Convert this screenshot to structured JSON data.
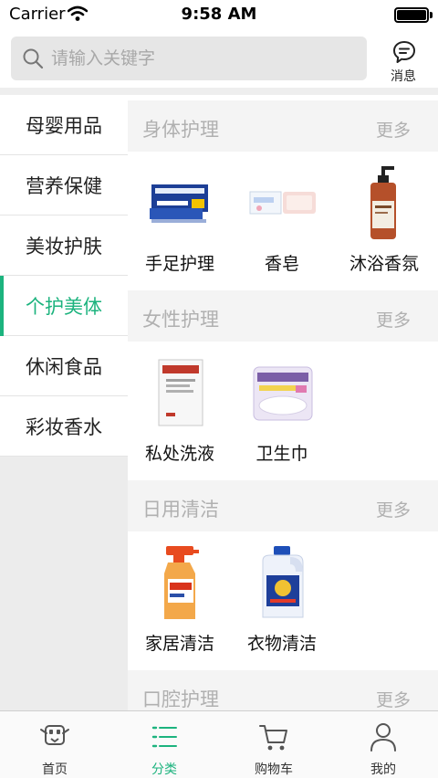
{
  "status_bar": {
    "carrier": "Carrier",
    "time": "9:58 AM"
  },
  "search": {
    "placeholder": "请输入关键字",
    "value": ""
  },
  "message_button": {
    "label": "消息",
    "icon": "chat-bubble-icon"
  },
  "sidebar": {
    "items": [
      {
        "label": "母婴用品"
      },
      {
        "label": "营养保健"
      },
      {
        "label": "美妆护肤"
      },
      {
        "label": "个护美体",
        "active": true
      },
      {
        "label": "休闲食品"
      },
      {
        "label": "彩妆香水"
      }
    ]
  },
  "sections": [
    {
      "title": "身体护理",
      "more": "更多",
      "products": [
        {
          "name": "手足护理",
          "icon": "cream-tube-icon"
        },
        {
          "name": "香皂",
          "icon": "soap-bar-icon"
        },
        {
          "name": "沐浴香氛",
          "icon": "pump-bottle-icon"
        }
      ]
    },
    {
      "title": "女性护理",
      "more": "更多",
      "products": [
        {
          "name": "私处洗液",
          "icon": "wash-sachet-icon"
        },
        {
          "name": "卫生巾",
          "icon": "pad-pack-icon"
        }
      ]
    },
    {
      "title": "日用清洁",
      "more": "更多",
      "products": [
        {
          "name": "家居清洁",
          "icon": "spray-bottle-icon"
        },
        {
          "name": "衣物清洁",
          "icon": "detergent-bottle-icon"
        }
      ]
    },
    {
      "title": "口腔护理",
      "more": "更多",
      "products": []
    }
  ],
  "tabbar": {
    "tabs": [
      {
        "label": "首页",
        "icon": "home-robot-icon"
      },
      {
        "label": "分类",
        "icon": "list-icon",
        "active": true
      },
      {
        "label": "购物车",
        "icon": "cart-icon"
      },
      {
        "label": "我的",
        "icon": "user-icon"
      }
    ]
  },
  "colors": {
    "accent": "#1cb37e",
    "muted_text": "#b0b0b0",
    "sidebar_bg": "#ececec"
  }
}
